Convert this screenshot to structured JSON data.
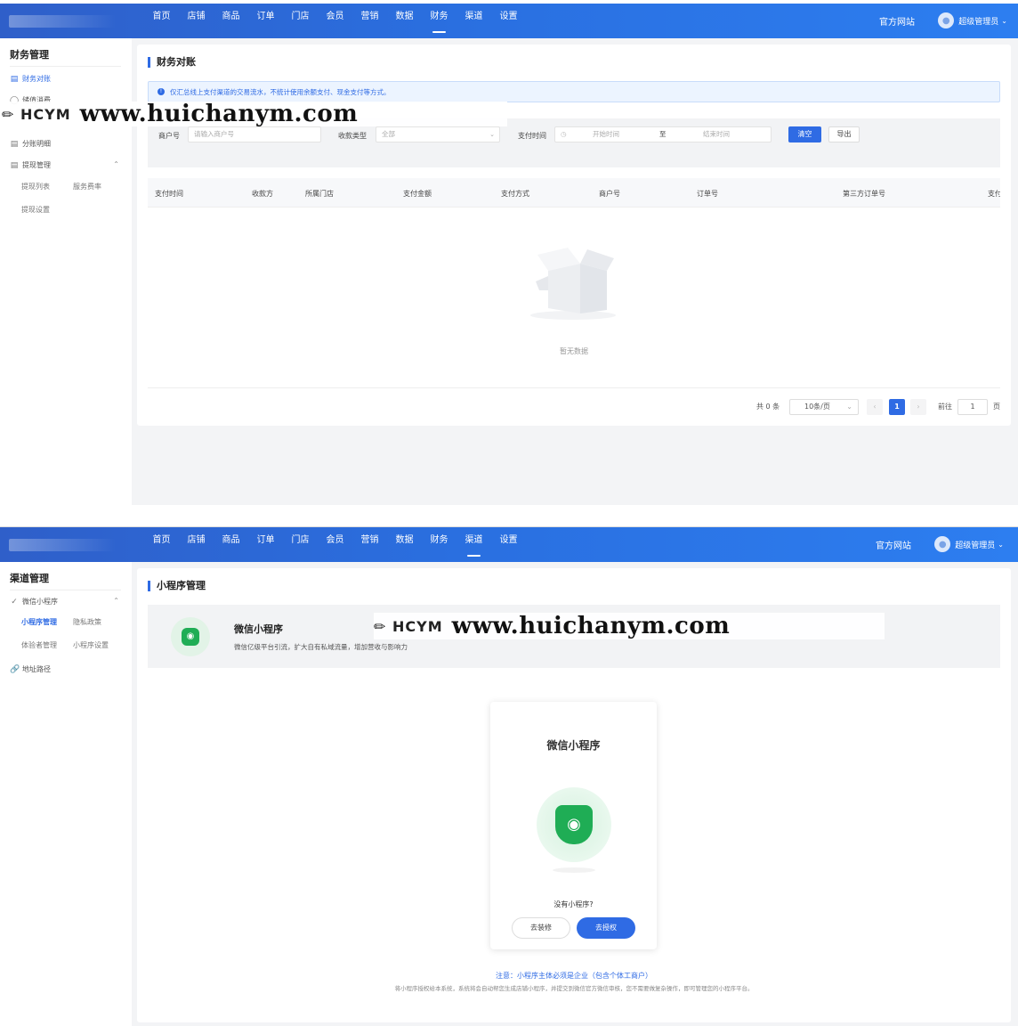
{
  "panel1": {
    "nav": [
      "首页",
      "店铺",
      "商品",
      "订单",
      "门店",
      "会员",
      "营销",
      "数据",
      "财务",
      "渠道",
      "设置"
    ],
    "nav_active": "财务",
    "site_link": "官方网站",
    "user": "超级管理员",
    "sidebar": {
      "title": "财务管理",
      "items": [
        "财务对账",
        "储值消费",
        "分账明细",
        "提现管理"
      ],
      "sub_items": [
        "提现列表",
        "服务费率",
        "提现设置"
      ]
    },
    "page_title": "财务对账",
    "notice": "仅汇总线上支付渠道的交易流水，不统计使用余额支付、现金支付等方式。",
    "filter": {
      "merchant_label": "商户号",
      "merchant_placeholder": "请输入商户号",
      "type_label": "收款类型",
      "type_value": "全部",
      "time_label": "支付时间",
      "start_placeholder": "开始时间",
      "to": "至",
      "end_placeholder": "结束时间",
      "clear_button": "清空",
      "export_button": "导出"
    },
    "table_headers": [
      "支付时间",
      "收款方",
      "所属门店",
      "支付金额",
      "支付方式",
      "商户号",
      "订单号",
      "第三方订单号",
      "支付"
    ],
    "empty_text": "暂无数据",
    "pagination": {
      "total": "共 0 条",
      "page_size": "10条/页",
      "current_page": "1",
      "goto_label": "前往",
      "goto_value": "1",
      "page_suffix": "页"
    }
  },
  "panel2": {
    "nav": [
      "首页",
      "店铺",
      "商品",
      "订单",
      "门店",
      "会员",
      "营销",
      "数据",
      "财务",
      "渠道",
      "设置"
    ],
    "nav_active": "渠道",
    "site_link": "官方网站",
    "user": "超级管理员",
    "sidebar": {
      "title": "渠道管理",
      "group": "微信小程序",
      "sub_items": [
        "小程序管理",
        "隐私政策",
        "体验者管理",
        "小程序设置"
      ],
      "item_path": "地址路径"
    },
    "page_title": "小程序管理",
    "banner": {
      "title": "微信小程序",
      "desc": "微信亿级平台引流，扩大自有私域流量，增加营收与影响力"
    },
    "card": {
      "title": "微信小程序",
      "question": "没有小程序?",
      "decorate_button": "去装修",
      "authorize_button": "去授权"
    },
    "note_main": "注意：小程序主体必须是企业（包含个体工商户）",
    "note_sub": "将小程序授权给本系统，系统将会自动帮您生成店铺小程序，并提交到微信官方微信审核，您不需要做复杂操作，即可管理您的小程序平台。"
  },
  "watermark": {
    "logo_text": "HCYM",
    "url": "www.huichanym.com"
  },
  "colors": {
    "primary": "#2f6be4",
    "topbar": "#2a6fe0",
    "wechat_green": "#1fad55"
  }
}
